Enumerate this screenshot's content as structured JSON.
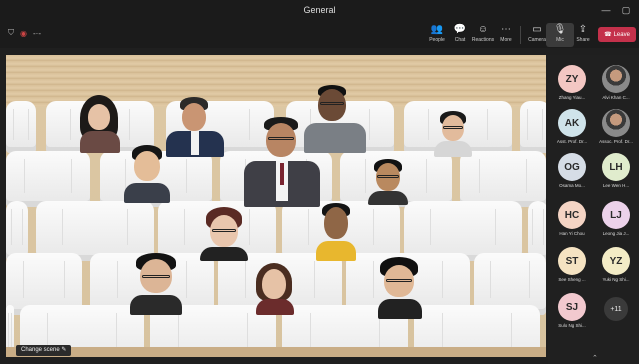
{
  "window": {
    "title": "General"
  },
  "toolbar": {
    "left_icons": [
      "shield-icon",
      "record-icon",
      "dots-icon"
    ],
    "buttons": [
      {
        "id": "people",
        "label": "People",
        "icon": "👥"
      },
      {
        "id": "chat",
        "label": "Chat",
        "icon": "💬"
      },
      {
        "id": "reactions",
        "label": "Reactions",
        "icon": "☺"
      },
      {
        "id": "more",
        "label": "More",
        "icon": "⋯"
      },
      {
        "id": "camera",
        "label": "Camera",
        "icon": "▭"
      },
      {
        "id": "mic",
        "label": "Mic",
        "icon": "🎙"
      },
      {
        "id": "share",
        "label": "Share",
        "icon": "⇪"
      }
    ],
    "leave": {
      "label": "Leave",
      "icon": "☎"
    }
  },
  "stage": {
    "change_scene_label": "Change scene ✎"
  },
  "participants": [
    {
      "initials": "ZY",
      "name": "Zhang Yiau...",
      "color": "#f3c7c3"
    },
    {
      "initials": "",
      "name": "Alvi Khan C...",
      "photo": true
    },
    {
      "initials": "AK",
      "name": "Asst. Prof. Dr...",
      "color": "#cfe3ea"
    },
    {
      "initials": "",
      "name": "Assoc. Prof. Dr...",
      "photo": true
    },
    {
      "initials": "OG",
      "name": "Osama Mo...",
      "color": "#d6dde6"
    },
    {
      "initials": "LH",
      "name": "Lee Wen H...",
      "color": "#e0eccd"
    },
    {
      "initials": "HC",
      "name": "Han Yi Chou",
      "color": "#f4d4c4"
    },
    {
      "initials": "LJ",
      "name": "Leong Jia J...",
      "color": "#ecd2ea"
    },
    {
      "initials": "ST",
      "name": "See Sheng ...",
      "color": "#f5e3c2"
    },
    {
      "initials": "YZ",
      "name": "Yuki Ng Shi...",
      "color": "#f3ecc6"
    },
    {
      "initials": "SJ",
      "name": "Sulo Ng Shi...",
      "color": "#f2c9cf"
    }
  ],
  "overflow": {
    "label": "+11"
  }
}
